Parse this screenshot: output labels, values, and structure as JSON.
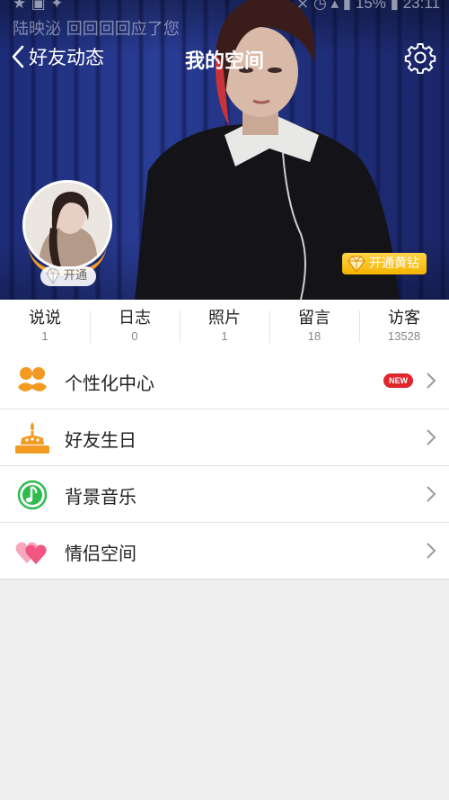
{
  "status_bar": {
    "time": "23:11",
    "battery": "15%",
    "notification_text": "陆映泌  回回回回应了您"
  },
  "navbar": {
    "back_label": "好友动态",
    "title": "我的空间"
  },
  "profile": {
    "vip_label": "开通",
    "yellow_diamond_label": "开通黄钻"
  },
  "stats": [
    {
      "label": "说说",
      "count": "1"
    },
    {
      "label": "日志",
      "count": "0"
    },
    {
      "label": "照片",
      "count": "1"
    },
    {
      "label": "留言",
      "count": "18"
    },
    {
      "label": "访客",
      "count": "13528"
    }
  ],
  "menu": [
    {
      "label": "个性化中心",
      "icon": "mustache-icon",
      "badge": "NEW"
    },
    {
      "label": "好友生日",
      "icon": "birthday-cake-icon"
    },
    {
      "label": "背景音乐",
      "icon": "music-note-icon"
    },
    {
      "label": "情侣空间",
      "icon": "hearts-icon"
    }
  ],
  "colors": {
    "accent_orange": "#f39a23",
    "yellow_diamond": "#f5b300",
    "new_badge": "#e0252b",
    "music_green": "#2dbb4c",
    "hearts_pink": "#f0567f"
  }
}
